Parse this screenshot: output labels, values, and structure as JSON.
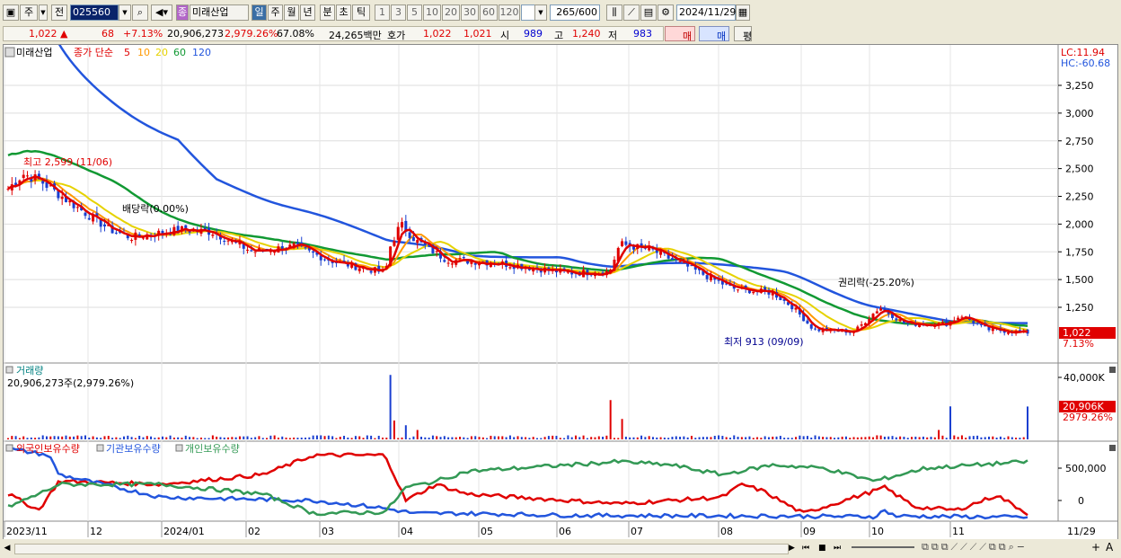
{
  "toolbar": {
    "period": "주",
    "prev": "전",
    "code": "025560",
    "stock_name": "미래산업",
    "type_badge": "종",
    "intervals": [
      "일",
      "주",
      "월",
      "년",
      "분",
      "초",
      "틱"
    ],
    "minutes": [
      "1",
      "3",
      "5",
      "10",
      "20",
      "30",
      "60",
      "120"
    ],
    "count_value": "265",
    "count_total": "/600",
    "date": "2024/11/29"
  },
  "info": {
    "price": "1,022",
    "arrow": "▲",
    "change": "68",
    "change_pct": "+7.13%",
    "volume": "20,906,273",
    "volume_pct": "2,979.26%",
    "turnover": "67.08%",
    "amount": "24,265백만",
    "quote_label": "호가",
    "ask": "1,022",
    "bid": "1,021",
    "open_label": "시",
    "open": "989",
    "high_label": "고",
    "high": "1,240",
    "low_label": "저",
    "low": "983",
    "buy_label": "매수",
    "sell_label": "매도",
    "avg_label": "평"
  },
  "price_panel": {
    "legend_name": "미래산업",
    "legend_ma_title": "종가 단순",
    "ma": [
      {
        "label": "5",
        "color": "#e00000"
      },
      {
        "label": "10",
        "color": "#ff9900"
      },
      {
        "label": "20",
        "color": "#e6d200"
      },
      {
        "label": "60",
        "color": "#119933"
      },
      {
        "label": "120",
        "color": "#2255dd"
      }
    ],
    "lc": "LC:11.94",
    "hc": "HC:-60.68",
    "yticks": [
      "3,250",
      "3,000",
      "2,750",
      "2,500",
      "2,250",
      "2,000",
      "1,750",
      "1,500",
      "1,250"
    ],
    "high_annot": "최고 2,599 (11/06)",
    "low_annot": "최저 913 (09/09)",
    "dividend_annot": "배당락(0.00%)",
    "rights_annot": "권리락(-25.20%)",
    "last_price_tag": "1,022",
    "last_pct_tag": "7.13%"
  },
  "volume_panel": {
    "title": "거래량",
    "value_label": "20,906,273주(2,979.26%)",
    "ytick": "40,000K",
    "tag": "20,906K",
    "tag_pct": "2979.26%"
  },
  "holding_panel": {
    "legend": [
      {
        "label": "외국인보유수량",
        "color": "#e00000"
      },
      {
        "label": "기관보유수량",
        "color": "#2255dd"
      },
      {
        "label": "개인보유수량",
        "color": "#339955"
      }
    ],
    "yticks": [
      "500,000",
      "0"
    ]
  },
  "xaxis": [
    "2023/11",
    "12",
    "2024/01",
    "02",
    "03",
    "04",
    "05",
    "06",
    "07",
    "08",
    "09",
    "10",
    "11"
  ],
  "xaxis_right": "11/29",
  "colors": {
    "up": "#e00000",
    "down": "#1a3fd0",
    "grid": "#d8d8d8"
  }
}
